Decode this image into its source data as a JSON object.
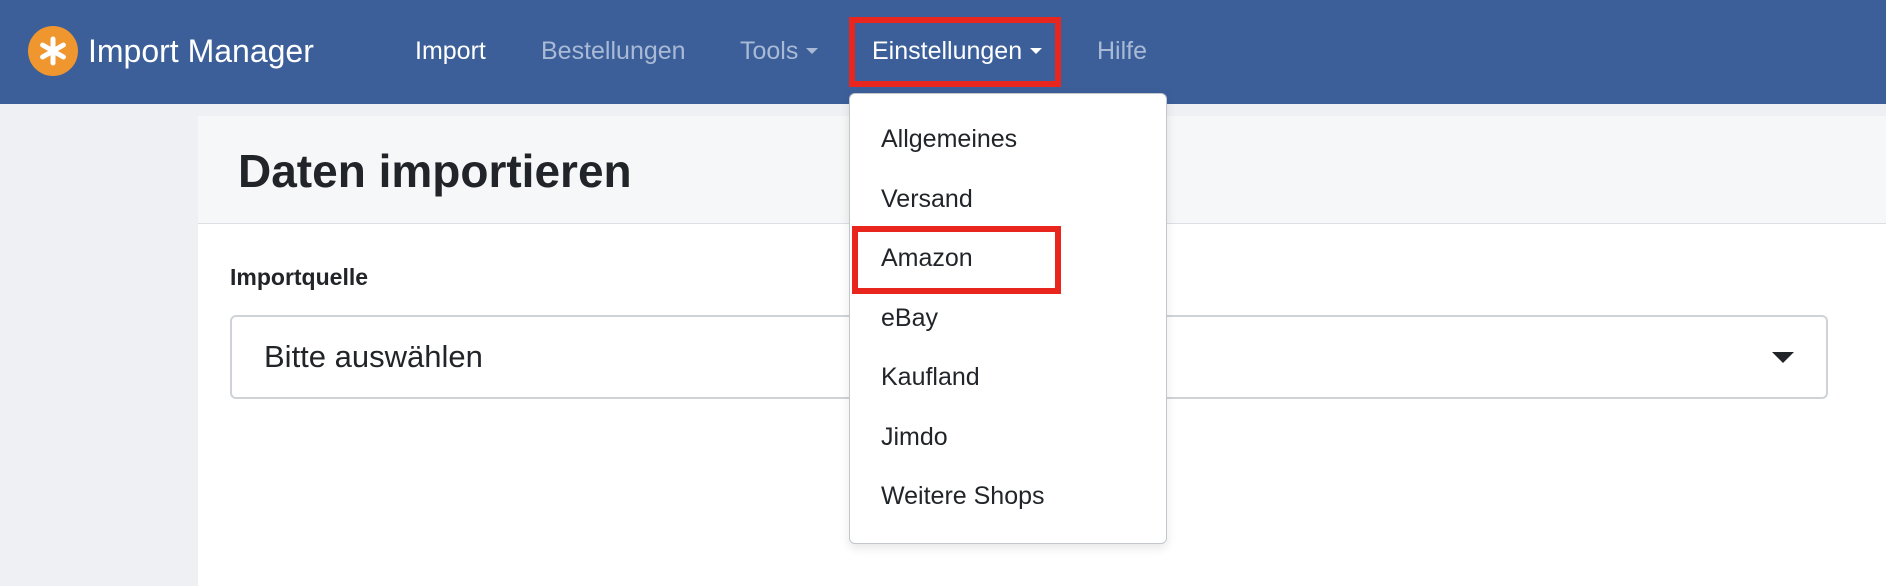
{
  "app": {
    "title": "Import Manager",
    "logo_icon": "asterisk-icon",
    "logo_color": "#f0962f",
    "navbar_color": "#3c5f99"
  },
  "nav": {
    "items": [
      {
        "label": "Import",
        "state": "active"
      },
      {
        "label": "Bestellungen",
        "state": "muted"
      },
      {
        "label": "Tools",
        "state": "muted",
        "has_dropdown": true
      },
      {
        "label": "Einstellungen",
        "state": "open",
        "has_dropdown": true
      },
      {
        "label": "Hilfe",
        "state": "muted"
      }
    ]
  },
  "settings_menu": {
    "items": [
      "Allgemeines",
      "Versand",
      "Amazon",
      "eBay",
      "Kaufland",
      "Jimdo",
      "Weitere Shops"
    ],
    "highlighted": "Amazon"
  },
  "page": {
    "title": "Daten importieren",
    "source_label": "Importquelle",
    "source_select_value": "Bitte auswählen"
  },
  "annotation": {
    "highlight_color": "#e8261d"
  }
}
